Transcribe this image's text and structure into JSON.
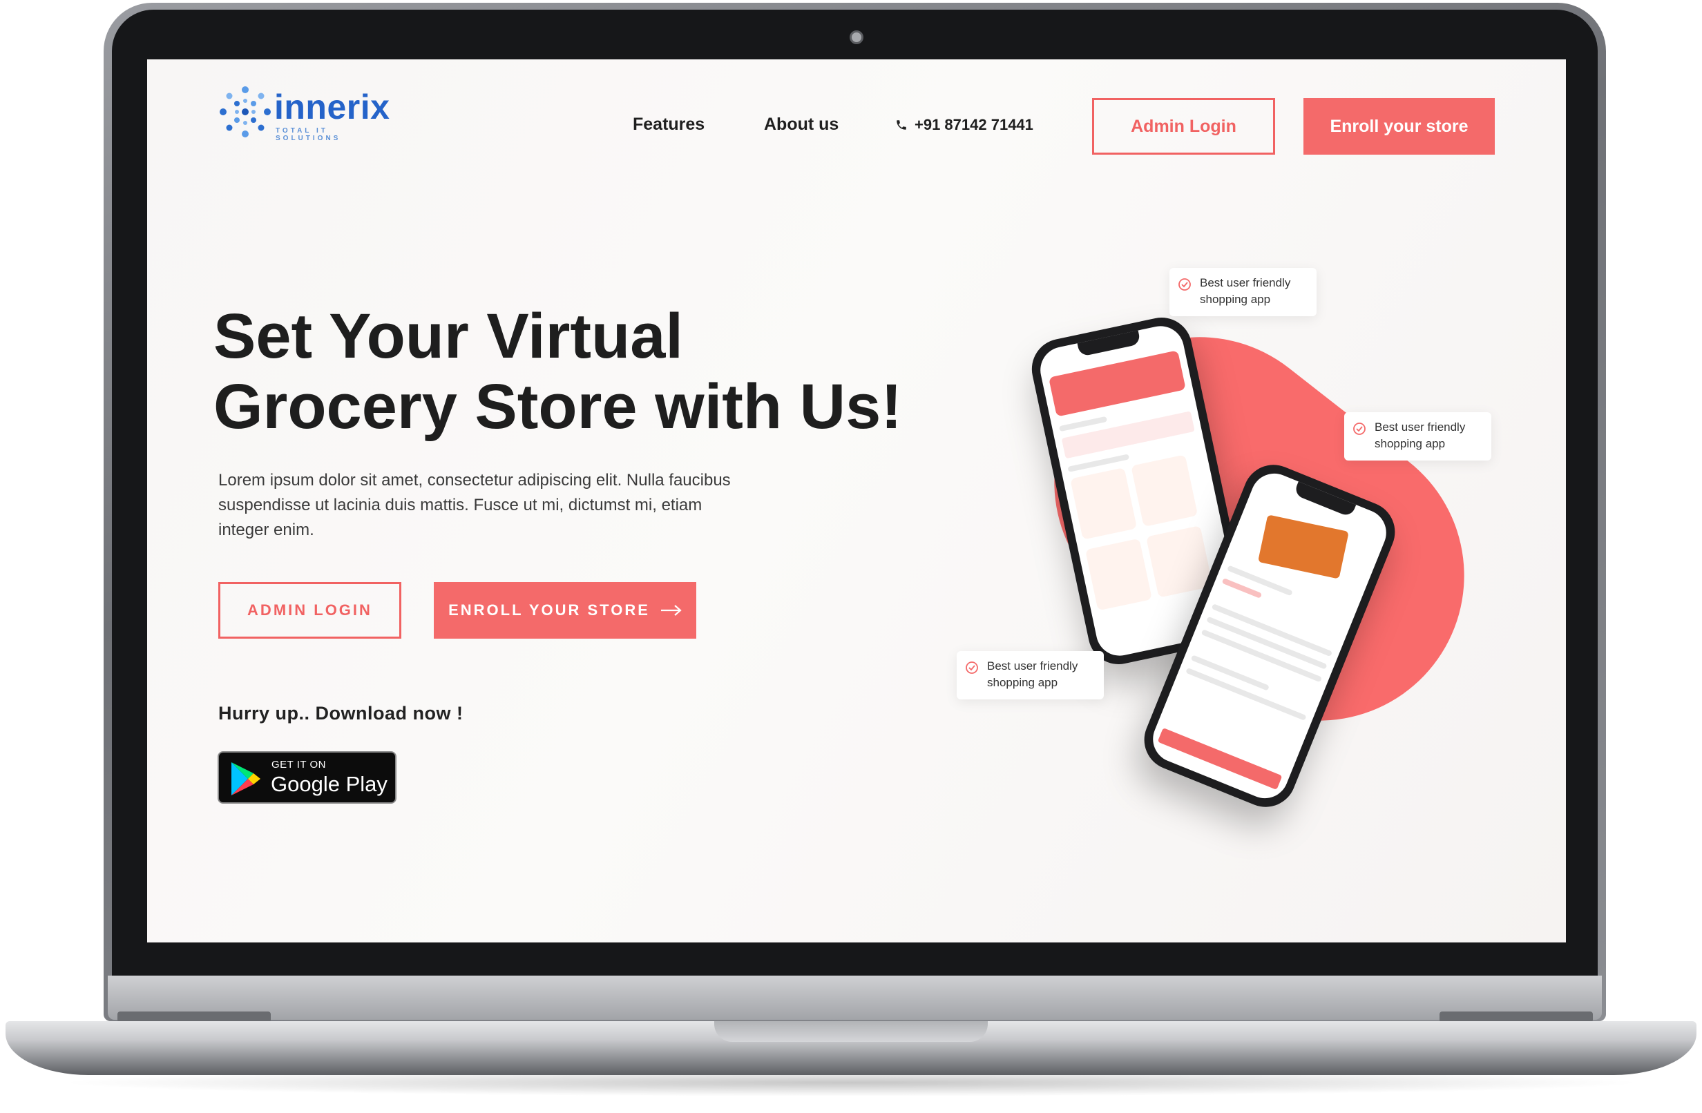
{
  "brand": {
    "name": "innerix",
    "tagline": "TOTAL IT SOLUTIONS",
    "color": "#2563c9"
  },
  "nav": {
    "features": "Features",
    "about": "About us",
    "phone": "+91 87142 71441",
    "admin_login": "Admin Login",
    "enroll": "Enroll your store"
  },
  "hero": {
    "title_line1": "Set Your Virtual",
    "title_line2": "Grocery Store with Us!",
    "body": "Lorem ipsum dolor sit amet, consectetur adipiscing elit. Nulla faucibus suspendisse ut lacinia duis mattis. Fusce ut mi, dictumst mi, etiam integer enim.",
    "admin_login": "ADMIN LOGIN",
    "enroll": "ENROLL YOUR STORE",
    "download_prompt": "Hurry up.. Download now !"
  },
  "google_play": {
    "small": "GET IT ON",
    "big": "Google Play"
  },
  "features": [
    {
      "line1": "Best user friendly",
      "line2": "shopping app"
    },
    {
      "line1": "Best user friendly",
      "line2": "shopping app"
    },
    {
      "line1": "Best user friendly",
      "line2": "shopping app"
    }
  ],
  "colors": {
    "accent": "#f46a6a",
    "accent_outline": "#f16262",
    "text_dark": "#1e1e1e"
  }
}
